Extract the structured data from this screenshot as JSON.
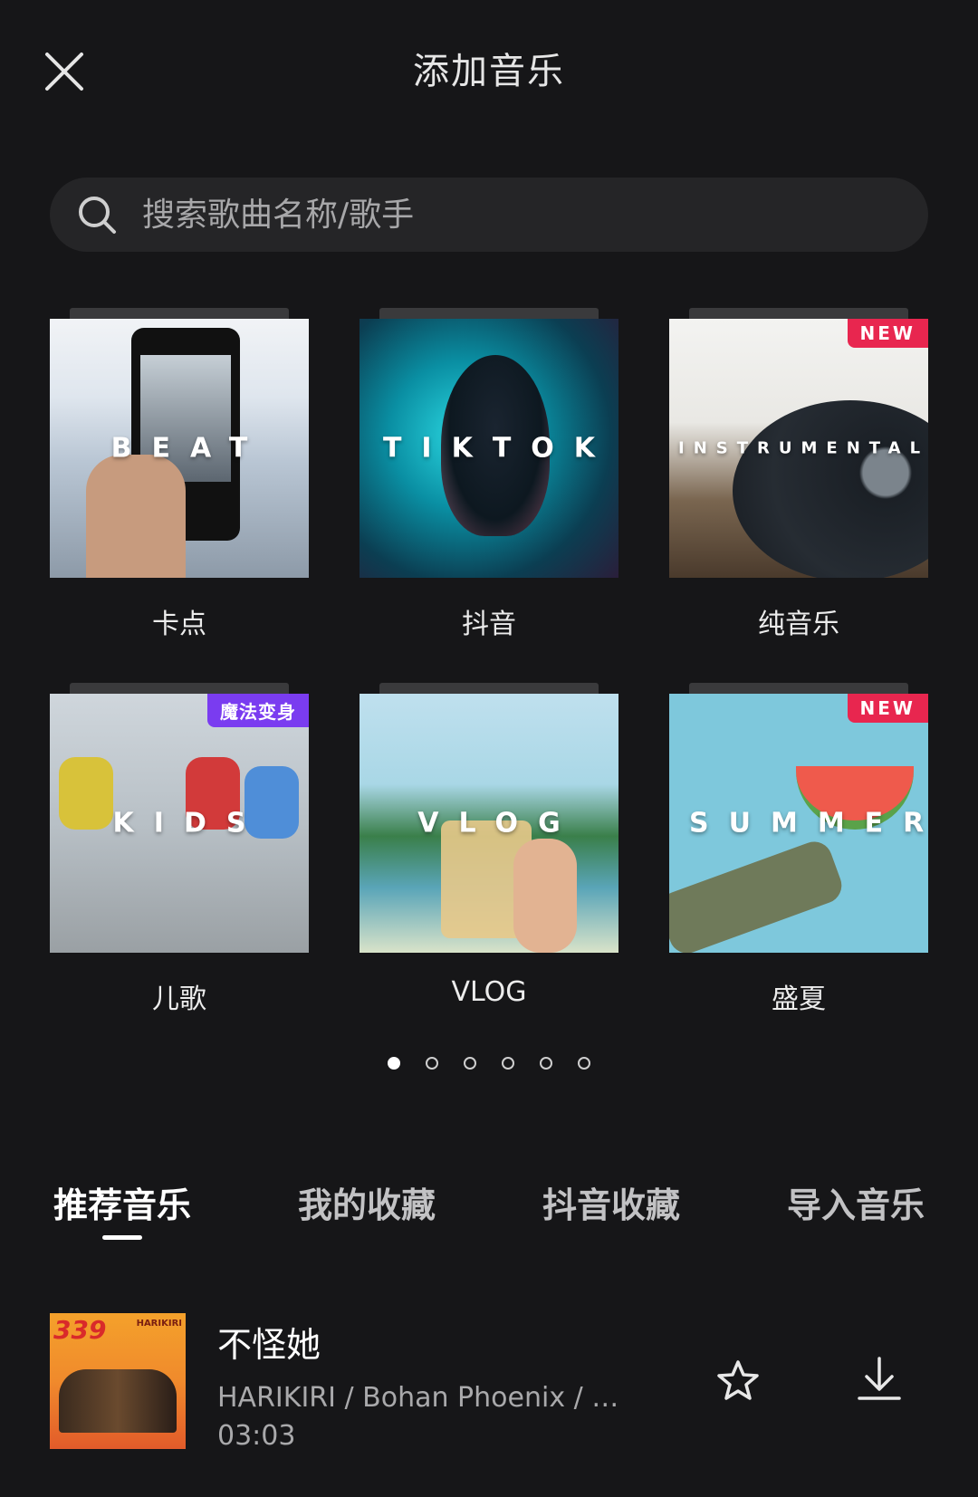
{
  "header": {
    "title": "添加音乐",
    "close_icon": "close-icon"
  },
  "search": {
    "placeholder": "搜索歌曲名称/歌手",
    "icon": "search-icon"
  },
  "categories": [
    {
      "caption": "卡点",
      "cover_text": "BEAT",
      "badge": ""
    },
    {
      "caption": "抖音",
      "cover_text": "TIKTOK",
      "badge": ""
    },
    {
      "caption": "纯音乐",
      "cover_text": "INSTRUMENTAL",
      "badge": "NEW"
    },
    {
      "caption": "儿歌",
      "cover_text": "KIDS",
      "badge": "魔法变身"
    },
    {
      "caption": "VLOG",
      "cover_text": "VLOG",
      "badge": ""
    },
    {
      "caption": "盛夏",
      "cover_text": "SUMMER",
      "badge": "NEW"
    }
  ],
  "pager": {
    "total": 6,
    "active": 1
  },
  "tabs": [
    {
      "label": "推荐音乐",
      "active": true
    },
    {
      "label": "我的收藏",
      "active": false
    },
    {
      "label": "抖音收藏",
      "active": false
    },
    {
      "label": "导入音乐",
      "active": false
    }
  ],
  "songs": [
    {
      "title": "不怪她",
      "artist": "HARIKIRI / Bohan Phoenix / 马…",
      "duration": "03:03",
      "cover_text": "339",
      "cover_subtext": "HARIKIRI"
    }
  ],
  "colors": {
    "background": "#161618",
    "search_bg": "#252527",
    "new_badge": "#e8264f",
    "magic_badge": "#7a3cf0"
  }
}
